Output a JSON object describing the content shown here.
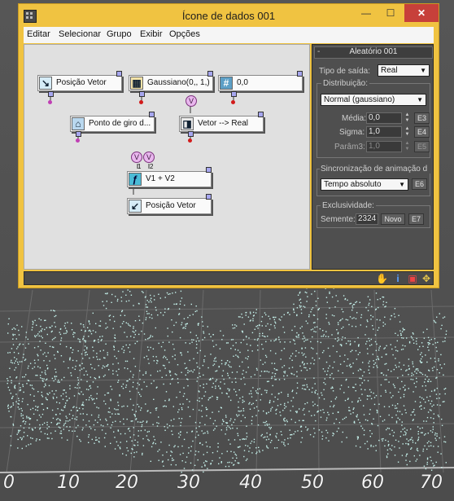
{
  "window": {
    "title": "Ícone de dados 001",
    "min_glyph": "—",
    "max_glyph": "☐",
    "close_glyph": "✕",
    "close_color": "#c7403a",
    "frame_color": "#f0c341"
  },
  "menu": [
    "Editar",
    "Selecionar",
    "Grupo",
    "Exibir",
    "Opções"
  ],
  "nodes": {
    "posicao_vetor_1": "Posição Vetor",
    "gaussiano": "Gaussiano(0,, 1,)",
    "valor": "0,0",
    "ponto_de_giro": "Ponto de giro d...",
    "vetor_real": "Vetor --> Real",
    "soma": "V1 + V2",
    "posicao_vetor_2": "Posição Vetor",
    "bubble_v": "V",
    "port_1": "1",
    "port_2": "2"
  },
  "panel": {
    "title": "Aleatório 001",
    "collapse": "-",
    "tipo_saida_label": "Tipo de saída:",
    "tipo_saida_value": "Real",
    "distribuicao_label": "Distribuição:",
    "distribuicao_value": "Normal (gaussiano)",
    "media_label": "Média:",
    "media_value": "0,0",
    "media_key": "E3",
    "sigma_label": "Sigma:",
    "sigma_value": "1,0",
    "sigma_key": "E4",
    "param3_label": "Parâm3:",
    "param3_value": "1,0",
    "param3_key": "E5",
    "sync_label": "Sincronização de animação d",
    "sync_value": "Tempo absoluto",
    "sync_key": "E6",
    "exclusividade_label": "Exclusividade:",
    "semente_label": "Semente:",
    "semente_value": "2324",
    "novo_label": "Novo",
    "semente_key": "E7"
  },
  "status_icons": [
    "hand-icon",
    "info-icon",
    "grid-icon",
    "move-icon"
  ],
  "axis_labels": [
    "0",
    "10",
    "20",
    "30",
    "40",
    "50",
    "60",
    "70"
  ]
}
